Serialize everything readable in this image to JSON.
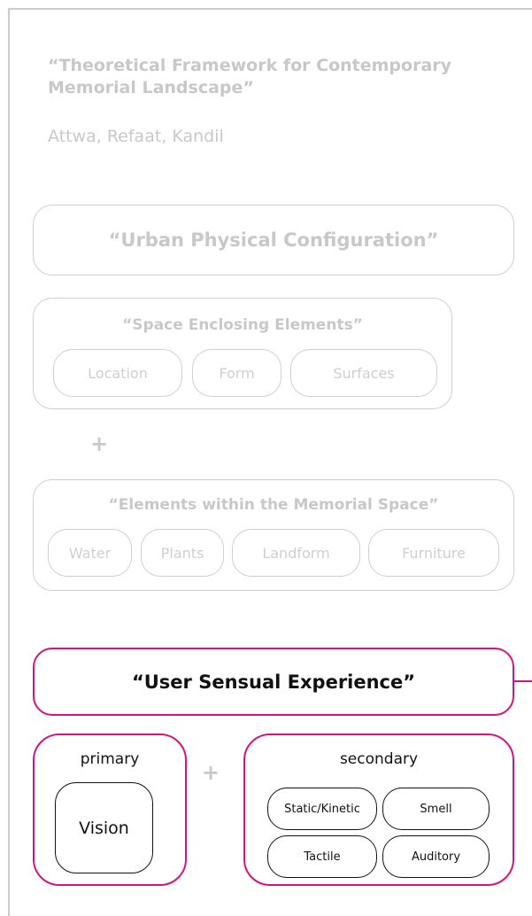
{
  "header": {
    "title": "“Theoretical Framework for Contemporary Memorial Landscape”",
    "authors": "Attwa, Refaat, Kandil"
  },
  "urban_physical": {
    "label": "“Urban Physical Configuration”",
    "space_enclosing": {
      "label": "“Space Enclosing Elements”",
      "items": [
        "Location",
        "Form",
        "Surfaces"
      ]
    },
    "plus": "+",
    "within_space": {
      "label": "“Elements within the Memorial Space”",
      "items": [
        "Water",
        "Plants",
        "Landform",
        "Furniture"
      ]
    }
  },
  "user_sensual": {
    "label": "“User Sensual Experience”",
    "primary": {
      "label": "primary",
      "items": [
        "Vision"
      ]
    },
    "plus": "+",
    "secondary": {
      "label": "secondary",
      "items": [
        "Static/Kinetic",
        "Smell",
        "Tactile",
        "Auditory"
      ]
    }
  },
  "colors": {
    "accent": "#d4147f",
    "muted": "#c8c8c8",
    "border_grey": "#cfcfcf"
  }
}
